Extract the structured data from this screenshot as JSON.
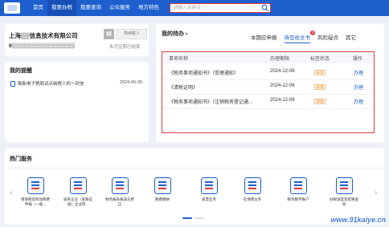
{
  "nav": {
    "items": [
      "首页",
      "我要办税",
      "我要查询",
      "公众服务",
      "地方特色"
    ],
    "active_index": 1
  },
  "search": {
    "placeholder": "请输入关键词"
  },
  "company": {
    "name": "上海▒▒信息技术有限公司",
    "code": "9▒▒▒▒▒▒▒▒▒▒▒▒▒▒▒▒",
    "avatar_letter": "M",
    "taxpayer_type": "简纳税人",
    "period_status": "本月征期已结束"
  },
  "reminders": {
    "title": "我的提醒",
    "items": [
      {
        "text": "致新电子税局试点纳税人的一封信",
        "date": "2024-06-28"
      }
    ]
  },
  "todo": {
    "title": "我的待办",
    "tabs": [
      {
        "label": "本期应申报",
        "badge": ""
      },
      {
        "label": "待签收文书",
        "badge": "3"
      },
      {
        "label": "风险疑点",
        "badge": ""
      },
      {
        "label": "其它",
        "badge": ""
      }
    ],
    "active_tab": 1,
    "columns": [
      "事项名称",
      "办理期限",
      "标签状态",
      "操作"
    ],
    "rows": [
      {
        "name": "《税务事项通知书》（受理通知）",
        "deadline": "2024-12-06",
        "status": "未读",
        "action": "办理"
      },
      {
        "name": "《清税证明》",
        "deadline": "2024-12-06",
        "status": "未读",
        "action": "办理"
      },
      {
        "name": "《税务事项通知书》（注销税务登记通...",
        "deadline": "2024-12-06",
        "status": "未读",
        "action": "办理"
      }
    ]
  },
  "hot_services": {
    "title": "热门服务",
    "items": [
      "增值税及附加税费申报（一般...",
      "居民企业（查账征收）企业所...",
      "财务报表报送与更正",
      "税费缴纳",
      "发票业务",
      "社保费业务",
      "税务数字账户",
      "办税进度及结果查询"
    ],
    "page_count": 2,
    "active_page": 0
  },
  "watermark": "www.91kaiye.cn",
  "colors": {
    "primary": "#1e5fce",
    "highlight": "#e23b3b",
    "status": "#e98b25"
  }
}
